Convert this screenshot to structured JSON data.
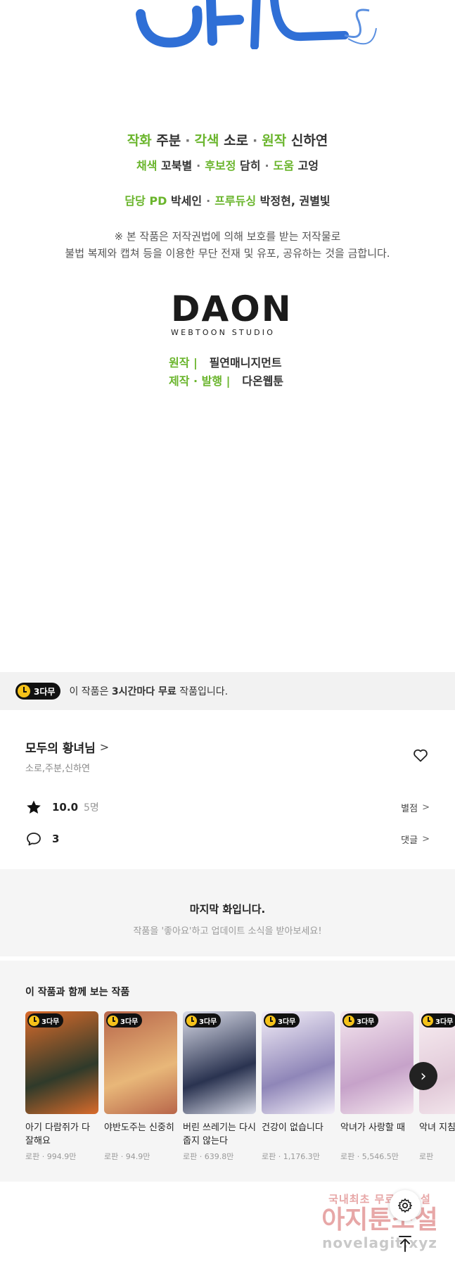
{
  "credits": {
    "line1": [
      {
        "role": "작화",
        "name": "주분"
      },
      {
        "role": "각색",
        "name": "소로"
      },
      {
        "role": "원작",
        "name": "신하연"
      }
    ],
    "line2": [
      {
        "role": "채색",
        "name": "꼬북별"
      },
      {
        "role": "후보정",
        "name": "담히"
      },
      {
        "role": "도움",
        "name": "고엉"
      }
    ],
    "line3": [
      {
        "role": "담당 PD",
        "name": "박세인"
      },
      {
        "role": "프루듀싱",
        "name": "박정현, 권별빛"
      }
    ],
    "separator": "·",
    "notice1": "※ 본 작품은 저작권법에 의해 보호를 받는 저작물로",
    "notice2": "불법 복제와 캡쳐 등을 이용한 무단 전재 및 유포, 공유하는 것을 금합니다."
  },
  "studio": {
    "logo": "DAON",
    "logo_sub": "WEBTOON STUDIO",
    "rows": [
      {
        "role": "원작 |",
        "name": "필연매니지먼트"
      },
      {
        "role": "제작 · 발행 |",
        "name": "다온웹툰"
      }
    ]
  },
  "free_banner": {
    "badge": "3다무",
    "text_pre": "이 작품은 ",
    "text_bold": "3시간마다 무료",
    "text_post": " 작품입니다."
  },
  "work": {
    "title": "모두의 황녀님",
    "title_chevron": ">",
    "authors": "소로,주분,신하연",
    "rating": "10.0",
    "rating_count": "5명",
    "rate_link": "별점",
    "comment_count": "3",
    "comment_link": "댓글",
    "chevron": ">"
  },
  "last_episode": {
    "title": "마지막 화입니다.",
    "subtitle": "작품을 '좋아요'하고 업데이트 소식을 받아보세요!"
  },
  "recommendations": {
    "title": "이 작품과 함께 보는 작품",
    "badge": "3다무",
    "items": [
      {
        "title": "아기 다람쥐가 다 잘해요",
        "meta": "로판 · 994.9만",
        "color1": "#2f3a2a",
        "color2": "#d96b2b"
      },
      {
        "title": "야반도주는 신중히",
        "meta": "로판 · 94.9만",
        "color1": "#e8b779",
        "color2": "#b8664a"
      },
      {
        "title": "버린 쓰레기는 다시 줍지 않는다",
        "meta": "로판 · 639.8만",
        "color1": "#2a3350",
        "color2": "#d9dbe8"
      },
      {
        "title": "건강이 없습니다",
        "meta": "로판 · 1,176.3만",
        "color1": "#8f86b8",
        "color2": "#f3eef8"
      },
      {
        "title": "악녀가 사랑할 때",
        "meta": "로판 · 5,546.5만",
        "color1": "#c6a2c9",
        "color2": "#f4e6ee"
      },
      {
        "title": "악녀 지침",
        "meta": "로판",
        "color1": "#e1c9d8",
        "color2": "#f8eef2"
      }
    ]
  },
  "watermark": {
    "line1": "국내최초 무료 웹소설",
    "line2": "아지툰소설",
    "line3": "novelagit.xyz"
  },
  "colors": {
    "accent_green": "#6ab52c",
    "title_blue": "#2f6fd6",
    "badge_yellow": "#f5c21a"
  },
  "icons": [
    "heart-icon",
    "star-icon",
    "comment-icon",
    "chevron-right-icon",
    "gear-icon",
    "arrow-up-icon",
    "clock-icon"
  ]
}
